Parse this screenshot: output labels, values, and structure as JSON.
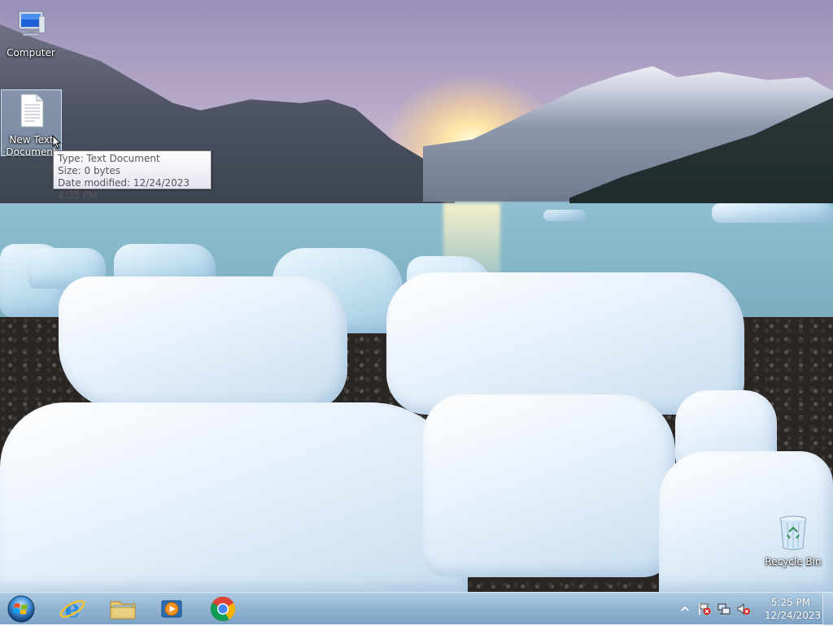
{
  "desktop": {
    "icons": [
      {
        "label": "Computer",
        "icon": "computer-icon"
      },
      {
        "label": "New Text Document",
        "icon": "text-document-icon"
      },
      {
        "label": "Recycle Bin",
        "icon": "recycle-bin-icon"
      }
    ],
    "tooltip": {
      "line1": "Type: Text Document",
      "line2": "Size: 0 bytes",
      "line3": "Date modified: 12/24/2023 4:35 PM"
    }
  },
  "taskbar": {
    "start": {
      "icon": "windows-start-icon"
    },
    "pinned": [
      {
        "icon": "internet-explorer-icon"
      },
      {
        "icon": "windows-explorer-icon"
      },
      {
        "icon": "media-player-icon"
      },
      {
        "icon": "chrome-icon"
      }
    ],
    "tray": {
      "icons": [
        "show-hidden-icons-chevron",
        "action-center-flag-icon",
        "network-icon",
        "volume-muted-icon"
      ],
      "time": "5:25 PM",
      "date": "12/24/2023"
    }
  },
  "colors": {
    "taskbar": "#8fb0cf",
    "selection": "#bfdcf9"
  }
}
